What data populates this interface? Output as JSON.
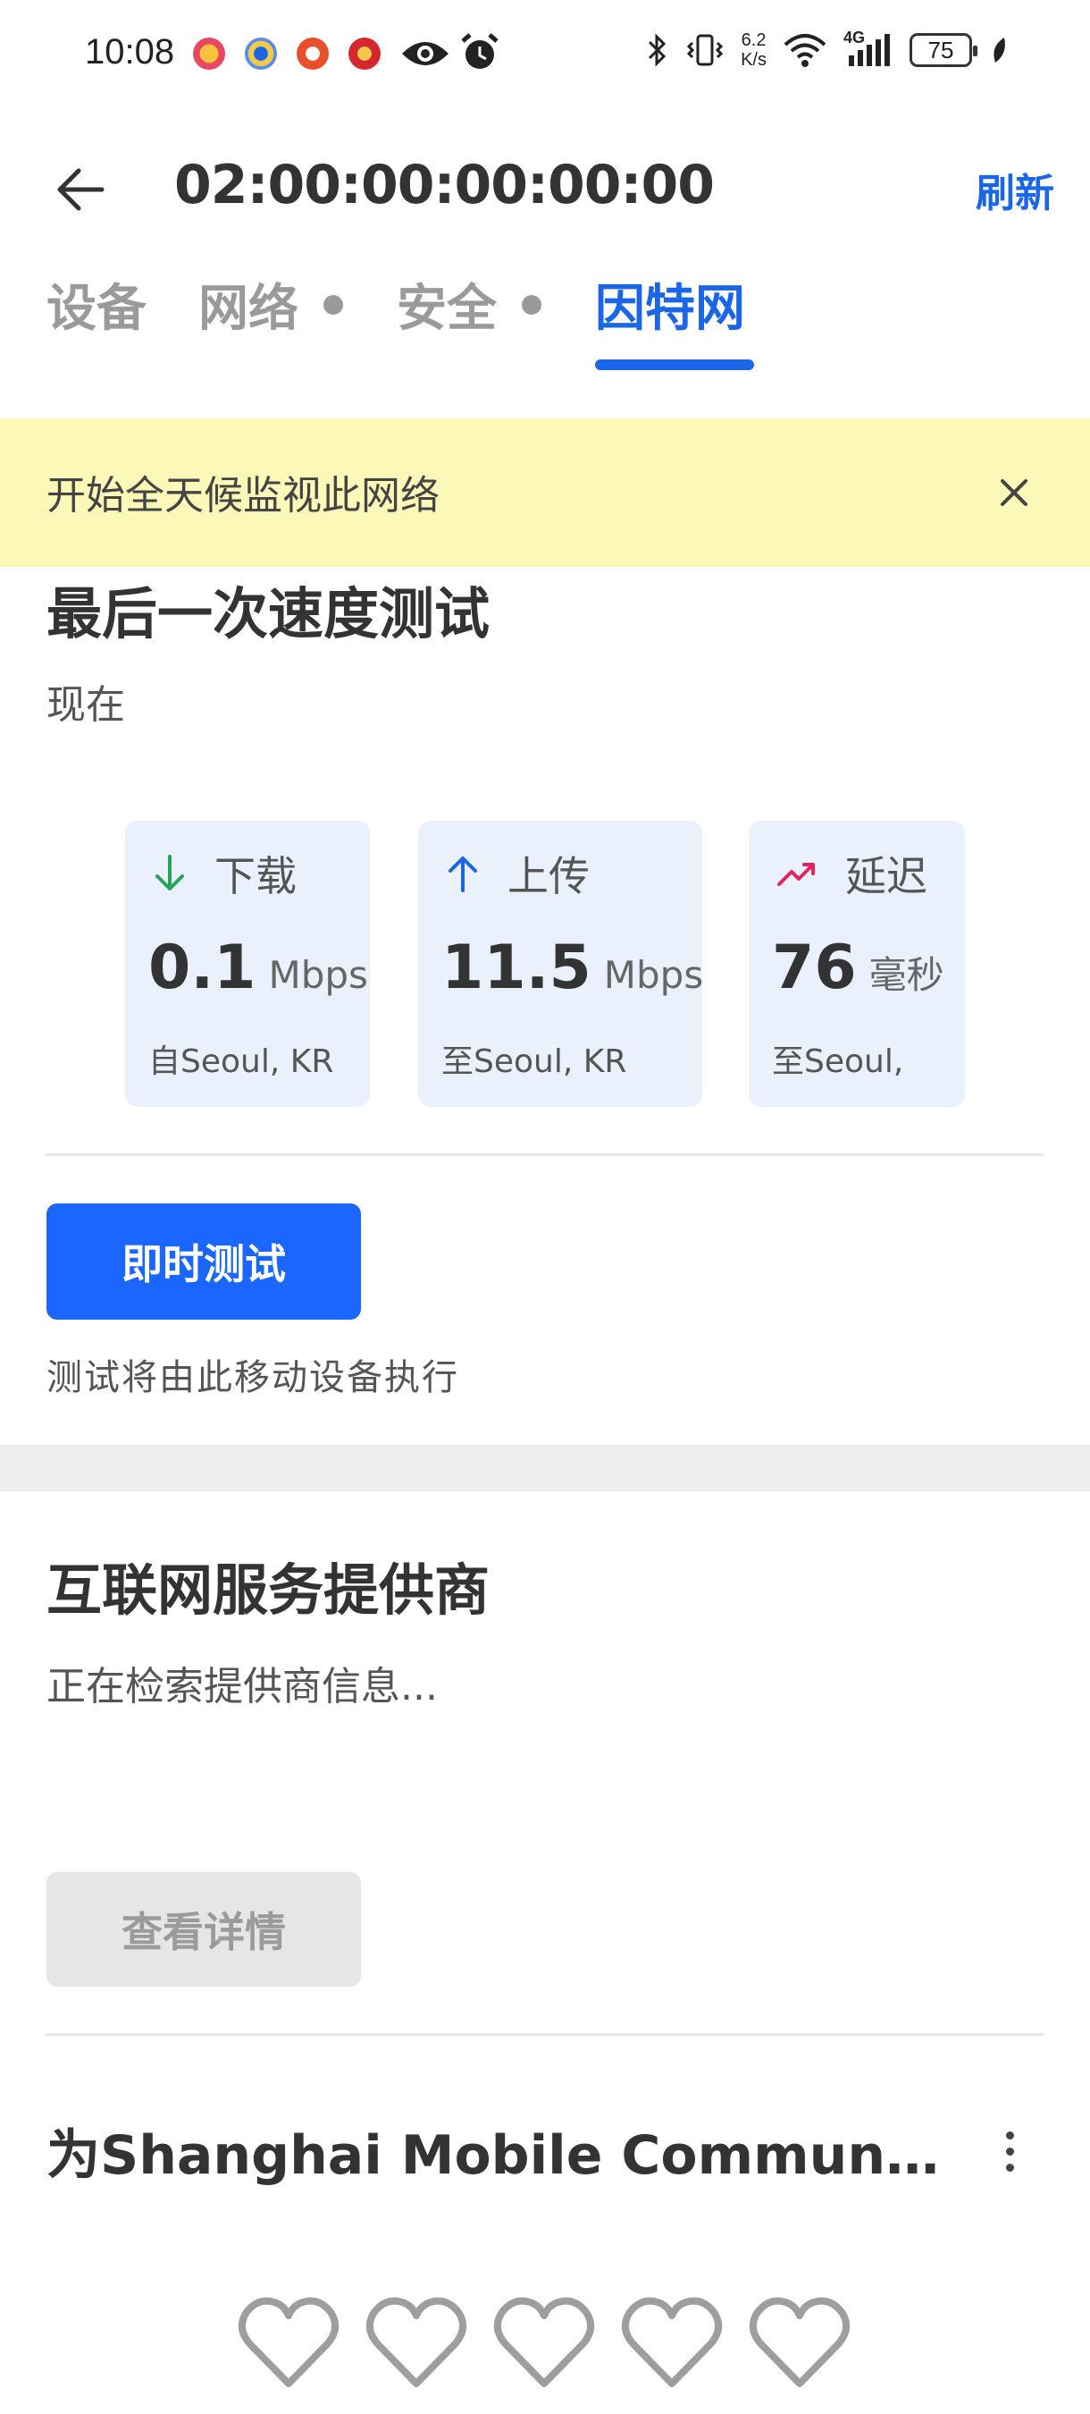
{
  "status_bar": {
    "time": "10:08",
    "network_speed_value": "6.2",
    "network_speed_unit": "K/s",
    "cell_label": "4G",
    "battery": "75"
  },
  "header": {
    "title": "02:00:00:00:00:00",
    "refresh_label": "刷新"
  },
  "tabs": [
    {
      "label": "设备",
      "dot": false,
      "active": false
    },
    {
      "label": "网络",
      "dot": true,
      "active": false
    },
    {
      "label": "安全",
      "dot": true,
      "active": false
    },
    {
      "label": "因特网",
      "dot": false,
      "active": true
    }
  ],
  "banner": {
    "text": "开始全天候监视此网络"
  },
  "speed_test": {
    "title": "最后一次速度测试",
    "time": "现在",
    "download": {
      "label": "下载",
      "value": "0.1",
      "unit": "Mbps",
      "location": "自Seoul, KR"
    },
    "upload": {
      "label": "上传",
      "value": "11.5",
      "unit": "Mbps",
      "location": "至Seoul, KR"
    },
    "latency": {
      "label": "延迟",
      "value": "76",
      "unit": "毫秒",
      "location": "至Seoul,"
    },
    "test_button": "即时测试",
    "note": "测试将由此移动设备执行"
  },
  "isp": {
    "title": "互联网服务提供商",
    "status": "正在检索提供商信息...",
    "details_button": "查看详情"
  },
  "rating": {
    "title": "为Shanghai Mobile Communications Co.,Ltd.评分",
    "stars_total": 5,
    "stars_filled": 0
  },
  "colors": {
    "accent": "#1a66e6",
    "banner_bg": "#fcf8b8",
    "card_bg": "#eaf1fd",
    "download_arrow": "#27a35a",
    "upload_arrow": "#1a66e6",
    "latency_arrow": "#e0245e"
  }
}
